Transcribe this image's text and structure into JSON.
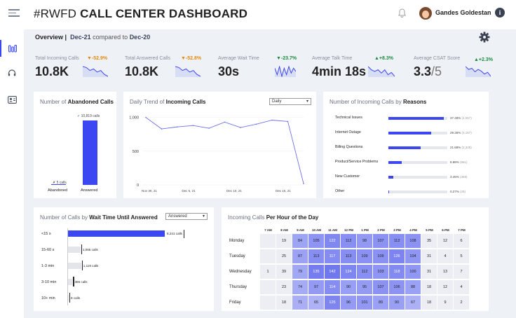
{
  "header": {
    "title_prefix": "#RWFD",
    "title_main": "CALL CENTER DASHBOARD",
    "user_name": "Gandes Goldestan",
    "info_label": "i"
  },
  "overview": {
    "label": "Overview",
    "separator": "|",
    "current": "Dec-21",
    "compared_text": "compared to",
    "previous": "Dec-20"
  },
  "kpis": [
    {
      "label": "Total Incoming Calls",
      "value": "10.8K",
      "change": "▼-52.9%",
      "direction": "down",
      "trend": [
        7,
        6.5,
        5,
        5.8,
        4.2,
        5,
        3,
        2
      ]
    },
    {
      "label": "Total Answered Calls",
      "value": "10.8K",
      "change": "▼-52.8%",
      "direction": "down",
      "trend": [
        7,
        6.5,
        5,
        5.8,
        4.2,
        5,
        3,
        2
      ]
    },
    {
      "label": "Average Wait Time",
      "value": "30s",
      "change": "▼-23.7%",
      "direction": "up",
      "trend": [
        6,
        2,
        7,
        1,
        6,
        2,
        7,
        3,
        6,
        4
      ]
    },
    {
      "label": "Average Talk Time",
      "value": "4min 18s",
      "change": "▲+8.3%",
      "direction": "up",
      "trend": [
        6,
        5,
        4.5,
        5,
        4,
        5,
        3.5,
        4.2,
        3
      ]
    },
    {
      "label": "Average CSAT Score",
      "value": "3.3",
      "value_suffix": "/5",
      "change": "▲+2.3%",
      "direction": "up",
      "trend": [
        5.5,
        5,
        5.2,
        4.6,
        5,
        4.7,
        4.2,
        4.5,
        3.8
      ]
    }
  ],
  "abandoned": {
    "title_prefix": "Number of",
    "title_bold": "Abandoned Calls",
    "answered_label": "Answered",
    "abandoned_label": "Abandoned",
    "answered_value_label": "✓ 10,819 calls",
    "abandoned_value_label": "✗ 5 calls",
    "answered": 10819,
    "abandoned": 5
  },
  "daily_trend": {
    "title_prefix": "Daily Trend of",
    "title_bold": "Incoming Calls",
    "select": "Daily",
    "chart_data": {
      "type": "line",
      "title": "Daily Trend of Incoming Calls",
      "x_ticks": [
        "Nov 30, 21",
        "Dec 5, 21",
        "Dec 10, 21",
        "Dec 15, 21"
      ],
      "y_ticks": [
        "1,000",
        "500",
        "0"
      ],
      "ylim": [
        0,
        1100
      ],
      "values": [
        1000,
        830,
        860,
        880,
        840,
        930,
        850,
        900,
        960,
        940,
        20
      ]
    }
  },
  "reasons": {
    "title_prefix": "Number of Incoming Calls by",
    "title_bold": "Reasons",
    "items": [
      {
        "label": "Technical Issues",
        "pct_text": "37.48%",
        "count_text": "(4,067)",
        "value": 37.48
      },
      {
        "label": "Internet Outage",
        "pct_text": "29.26%",
        "count_text": "(3,167)",
        "value": 29.26
      },
      {
        "label": "Billing Questions",
        "pct_text": "21.68%",
        "count_text": "(2,345)",
        "value": 21.68
      },
      {
        "label": "Product/Service Problems",
        "pct_text": "8.88%",
        "count_text": "(961)",
        "value": 8.88
      },
      {
        "label": "New Customer",
        "pct_text": "3.45%",
        "count_text": "(369)",
        "value": 3.45
      },
      {
        "label": "Other",
        "pct_text": "0.27%",
        "count_text": "(29)",
        "value": 0.27
      }
    ]
  },
  "wait_time": {
    "title_prefix": "Number of Calls by",
    "title_bold": "Wait Time Until Answered",
    "select": "Answered",
    "rows": [
      {
        "label": "<15 s",
        "value_text": "8,241 calls",
        "value": 8241,
        "highlight": true
      },
      {
        "label": "15-60 s",
        "value_text": "1,065 calls",
        "value": 1065,
        "highlight": false
      },
      {
        "label": "1-3 min",
        "value_text": "1,119 calls",
        "value": 1119,
        "highlight": false
      },
      {
        "label": "3-10 min",
        "value_text": "386 calls",
        "value": 386,
        "highlight": false
      },
      {
        "label": "10+ min",
        "value_text": "8 calls",
        "value": 8,
        "highlight": false
      }
    ]
  },
  "heatmap": {
    "title_prefix": "Incoming Calls",
    "title_bold": "Per Hour of the Day",
    "hours": [
      "7 AM",
      "8 AM",
      "9 AM",
      "10 AM",
      "11 AM",
      "12 PM",
      "1 PM",
      "2 PM",
      "3 PM",
      "4 PM",
      "5 PM",
      "6 PM",
      "7 PM"
    ],
    "rows": [
      {
        "day": "Monday",
        "values": [
          null,
          19,
          84,
          105,
          122,
          112,
          98,
          107,
          112,
          108,
          35,
          12,
          6
        ]
      },
      {
        "day": "Tuesday",
        "values": [
          null,
          25,
          87,
          113,
          117,
          113,
          109,
          109,
          126,
          104,
          31,
          4,
          5
        ]
      },
      {
        "day": "Wednesday",
        "values": [
          1,
          39,
          79,
          135,
          142,
          124,
          112,
          103,
          118,
          100,
          31,
          13,
          7
        ]
      },
      {
        "day": "Thursday",
        "values": [
          null,
          23,
          74,
          97,
          114,
          90,
          95,
          107,
          106,
          88,
          18,
          12,
          4
        ]
      },
      {
        "day": "Friday",
        "values": [
          null,
          18,
          71,
          65,
          125,
          96,
          101,
          89,
          90,
          67,
          18,
          9,
          2
        ]
      }
    ]
  },
  "colors": {
    "accent": "#3b47f0",
    "up": "#1a8b3e",
    "down": "#e38a0d",
    "background": "#eef1f6"
  }
}
